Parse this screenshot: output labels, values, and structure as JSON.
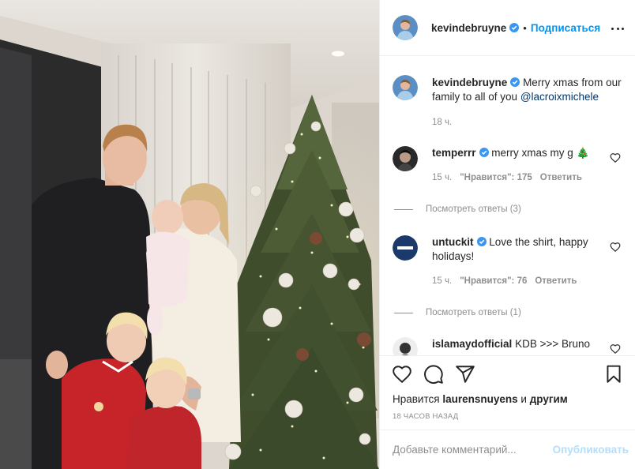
{
  "colors": {
    "accent": "#0095f6",
    "verified": "#3897f0",
    "muted": "#8e8e8e",
    "text": "#262626",
    "publish_disabled": "#b2dffc"
  },
  "header": {
    "username": "kevindebruyne",
    "dot": "•",
    "follow_label": "Подписаться"
  },
  "caption": {
    "username": "kevindebruyne",
    "text": "Merry xmas from our family to all of you",
    "mention": "@lacroixmichele",
    "time": "18 ч."
  },
  "comments": [
    {
      "username": "temperrr",
      "text": "merry xmas my g 🎄",
      "time": "15 ч.",
      "likes": "\"Нравится\": 175",
      "reply": "Ответить",
      "view_replies": "Посмотреть ответы (3)"
    },
    {
      "username": "untuckit",
      "text": "Love the shirt, happy holidays!",
      "time": "15 ч.",
      "likes": "\"Нравится\": 76",
      "reply": "Ответить",
      "view_replies": "Посмотреть ответы (1)"
    },
    {
      "username": "islamaydofficial",
      "text": "KDB >>> Bruno"
    }
  ],
  "actions": {
    "icons": [
      "heart-icon",
      "comment-icon",
      "share-icon",
      "bookmark-icon"
    ],
    "likes_prefix": "Нравится",
    "likes_user": "laurensnuyens",
    "likes_mid": "и",
    "likes_others": "другим",
    "timestamp": "18 ЧАСОВ НАЗАД"
  },
  "add_comment": {
    "placeholder": "Добавьте комментарий...",
    "publish_label": "Опубликовать"
  }
}
